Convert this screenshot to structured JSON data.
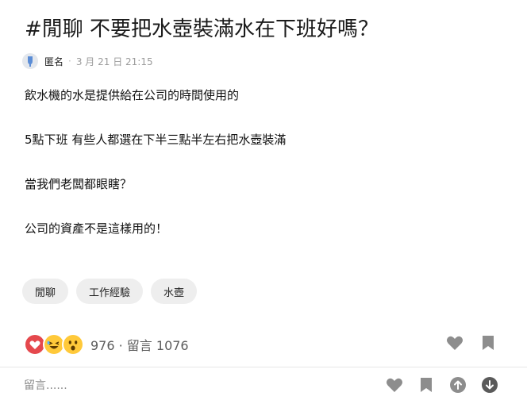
{
  "post": {
    "title": "#閒聊 不要把水壺裝滿水在下班好嗎？",
    "author": "匿名",
    "separator": "·",
    "time": "3 月 21 日 21:15",
    "paragraphs": [
      "飲水機的水是提供給在公司的時間使用的",
      "5點下班 有些人都選在下半三點半左右把水壺裝滿",
      "當我們老闆都眼瞎？",
      "公司的資產不是這樣用的！"
    ],
    "tags": [
      "閒聊",
      "工作經驗",
      "水壺"
    ]
  },
  "stats": {
    "reactions": [
      "heart-icon",
      "laughing-emoji-icon",
      "surprised-emoji-icon"
    ],
    "text": "976 · 留言 1076"
  },
  "comment_bar": {
    "placeholder": "留言......"
  },
  "colors": {
    "heart": "#e5484d",
    "emoji_yellow": "#ffc93a",
    "icon_gray": "#8d8d8d",
    "icon_dark": "#5a5a5a"
  }
}
